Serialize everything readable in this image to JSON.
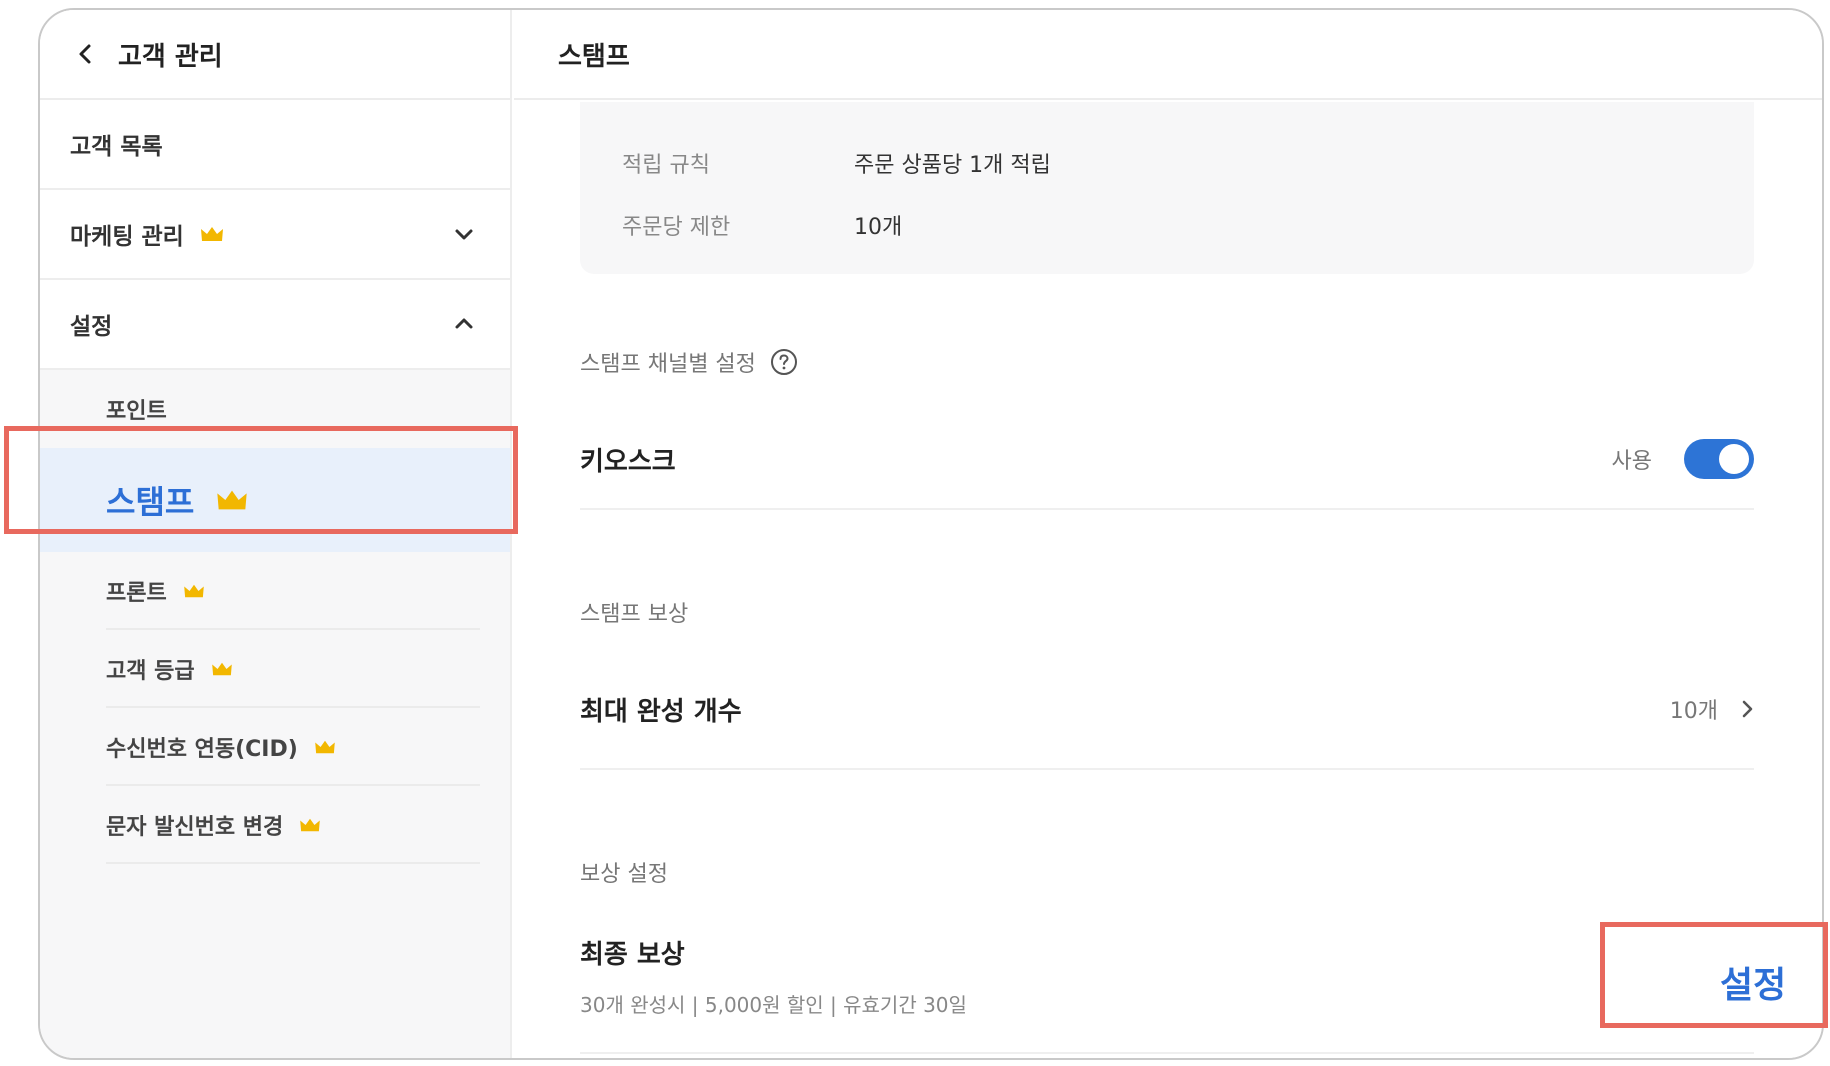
{
  "sidebar": {
    "title": "고객 관리",
    "items": [
      {
        "label": "고객 목록"
      },
      {
        "label": "마케팅 관리",
        "premium": true
      },
      {
        "label": "설정"
      }
    ],
    "settings_sub": [
      {
        "label": "포인트",
        "premium": false
      },
      {
        "label": "스탬프",
        "premium": true,
        "active": true
      },
      {
        "label": "프론트",
        "premium": true
      },
      {
        "label": "고객 등급",
        "premium": true
      },
      {
        "label": "수신번호 연동(CID)",
        "premium": true
      },
      {
        "label": "문자 발신번호 변경",
        "premium": true
      }
    ]
  },
  "main": {
    "title": "스탬프",
    "info": [
      {
        "key": "적립 규칙",
        "value": "주문 상품당 1개 적립"
      },
      {
        "key": "주문당 제한",
        "value": "10개"
      }
    ],
    "channel_section": "스탬프 채널별 설정",
    "kiosk": {
      "label": "키오스크",
      "status": "사용",
      "enabled": true
    },
    "reward_section": "스탬프 보상",
    "max_complete": {
      "label": "최대 완성 개수",
      "value": "10개"
    },
    "reward_setting_section": "보상 설정",
    "final_reward": {
      "label": "최종 보상",
      "detail": "30개 완성시  |  5,000원 할인  |  유효기간 30일",
      "button": "설정"
    }
  },
  "colors": {
    "accent": "#2d6fd6",
    "highlight": "#e8695e",
    "crown": "#f2b700"
  }
}
